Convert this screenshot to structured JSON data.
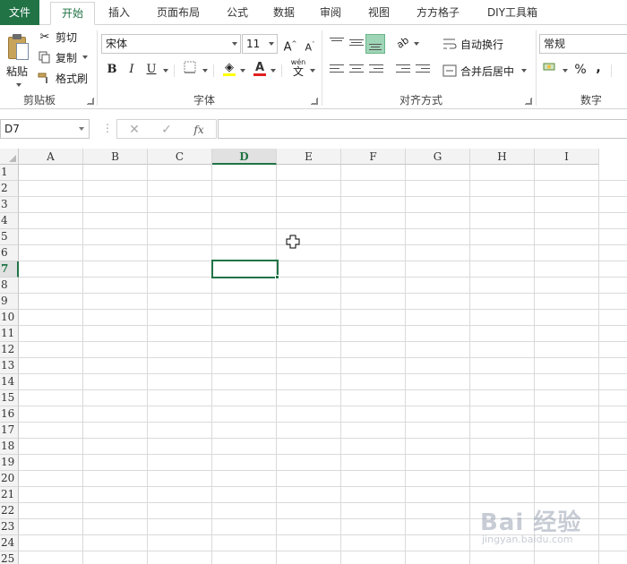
{
  "tabs": [
    {
      "label": "文件",
      "kind": "file"
    },
    {
      "label": "开始",
      "kind": "active"
    },
    {
      "label": "插入"
    },
    {
      "label": "页面布局"
    },
    {
      "label": "公式"
    },
    {
      "label": "数据"
    },
    {
      "label": "审阅"
    },
    {
      "label": "视图"
    },
    {
      "label": "方方格子"
    },
    {
      "label": "DIY工具箱"
    }
  ],
  "clipboard": {
    "paste_label": "粘贴",
    "cut_label": "剪切",
    "copy_label": "复制",
    "format_painter_label": "格式刷",
    "group_label": "剪贴板"
  },
  "font": {
    "font_name": "宋体",
    "font_size": "11",
    "bold": "B",
    "italic": "I",
    "underline": "U",
    "phonetic": "wén",
    "phonetic_char": "文",
    "group_label": "字体",
    "highlight_color": "#ffff00",
    "font_color": "#e02020"
  },
  "alignment": {
    "wrap_text_label": "自动换行",
    "merge_center_label": "合并后居中",
    "group_label": "对齐方式"
  },
  "number": {
    "format": "常规",
    "percent": "%",
    "comma": ",",
    "group_label": "数字"
  },
  "formula_bar": {
    "name_box": "D7",
    "cancel_icon": "✕",
    "enter_icon": "✓",
    "fx_label": "fx",
    "formula": ""
  },
  "grid": {
    "columns": [
      "A",
      "B",
      "C",
      "D",
      "E",
      "F",
      "G",
      "H",
      "I"
    ],
    "rows": [
      "1",
      "2",
      "3",
      "4",
      "5",
      "6",
      "7",
      "8",
      "9",
      "10",
      "11",
      "12",
      "13",
      "14",
      "15",
      "16",
      "17",
      "18",
      "19",
      "20",
      "21",
      "22",
      "23",
      "24",
      "25"
    ],
    "selected_column": "D",
    "selected_row": "7",
    "active_cell": "D7"
  },
  "watermark": {
    "text": "Bai 经验",
    "sub": "jingyan.baidu.com"
  },
  "colors": {
    "accent": "#217346"
  }
}
